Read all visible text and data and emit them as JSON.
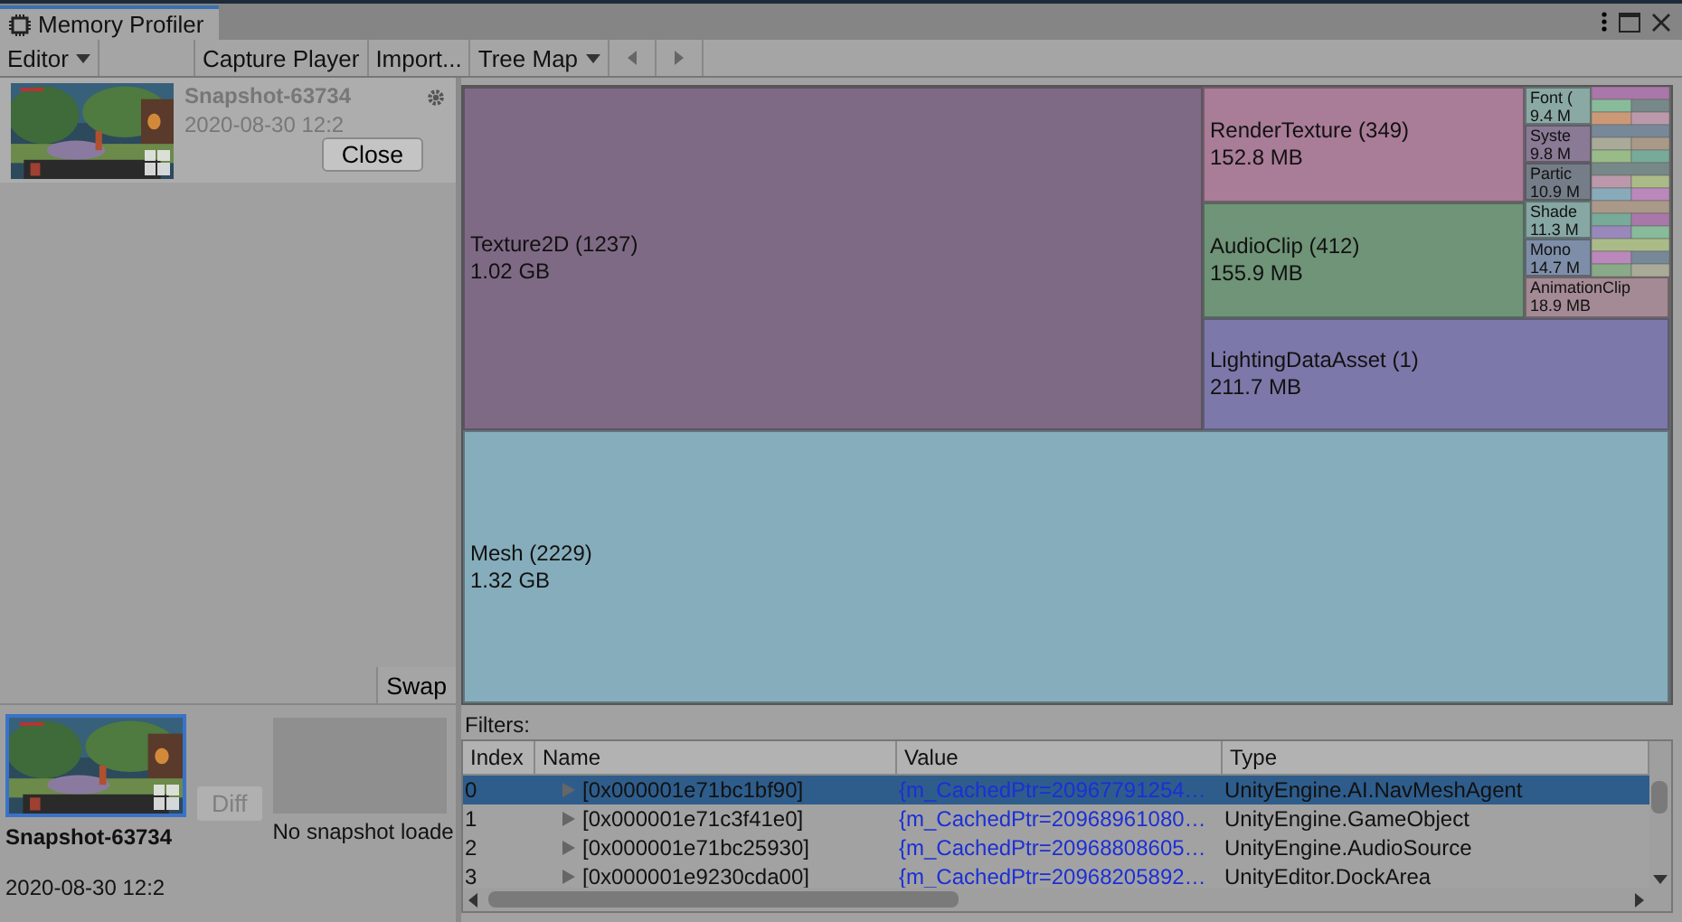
{
  "window": {
    "title": "Memory Profiler"
  },
  "toolbar": {
    "target": "Editor",
    "buttons": [
      "Capture Player",
      "Import..."
    ],
    "view": "Tree Map"
  },
  "snapshot_list": [
    {
      "name": "Snapshot-63734",
      "date": "2020-08-30 12:2",
      "close": "Close"
    }
  ],
  "swap": "Swap",
  "compare": {
    "first": {
      "name": "Snapshot-63734",
      "date": "2020-08-30 12:2",
      "selected": true
    },
    "diff": {
      "label": "Diff",
      "disabled": true
    },
    "second": {
      "label": "No snapshot loade"
    }
  },
  "treemap": {
    "cells": [
      {
        "name": "Texture2D (1237)",
        "size": "1.02 GB",
        "color": "#7f6a86"
      },
      {
        "name": "Mesh (2229)",
        "size": "1.32 GB",
        "color": "#86adbb"
      },
      {
        "name": "RenderTexture (349)",
        "size": "152.8 MB",
        "color": "#a97c98"
      },
      {
        "name": "AudioClip (412)",
        "size": "155.9 MB",
        "color": "#6f9478"
      },
      {
        "name": "LightingDataAsset (1)",
        "size": "211.7 MB",
        "color": "#7c78a9"
      },
      {
        "name": "Font (",
        "size": "9.4 M",
        "color": "#8aa9a4"
      },
      {
        "name": "Syste",
        "size": "9.8 M",
        "color": "#8a7a95"
      },
      {
        "name": "Partic",
        "size": "10.9 M",
        "color": "#757d88"
      },
      {
        "name": "Shade",
        "size": "11.3 M",
        "color": "#86a7a3"
      },
      {
        "name": "Mono",
        "size": "14.7 M",
        "color": "#7f8ea8"
      },
      {
        "name": "AnimationClip",
        "size": "18.9 MB",
        "color": "#a48a94"
      }
    ]
  },
  "table": {
    "filters_label": "Filters:",
    "columns": [
      "Index",
      "Name",
      "Value",
      "Type"
    ],
    "rows": [
      {
        "index": "0",
        "name": "[0x000001e71bc1bf90]",
        "value": "{m_CachedPtr=20967791254…",
        "type": "UnityEngine.AI.NavMeshAgent",
        "selected": true
      },
      {
        "index": "1",
        "name": "[0x000001e71c3f41e0]",
        "value": "{m_CachedPtr=20968961080…",
        "type": "UnityEngine.GameObject",
        "selected": false
      },
      {
        "index": "2",
        "name": "[0x000001e71bc25930]",
        "value": "{m_CachedPtr=20968808605…",
        "type": "UnityEngine.AudioSource",
        "selected": false
      },
      {
        "index": "3",
        "name": "[0x000001e9230cda00]",
        "value": "{m_CachedPtr=20968205892…",
        "type": "UnityEditor.DockArea",
        "selected": false
      }
    ]
  }
}
